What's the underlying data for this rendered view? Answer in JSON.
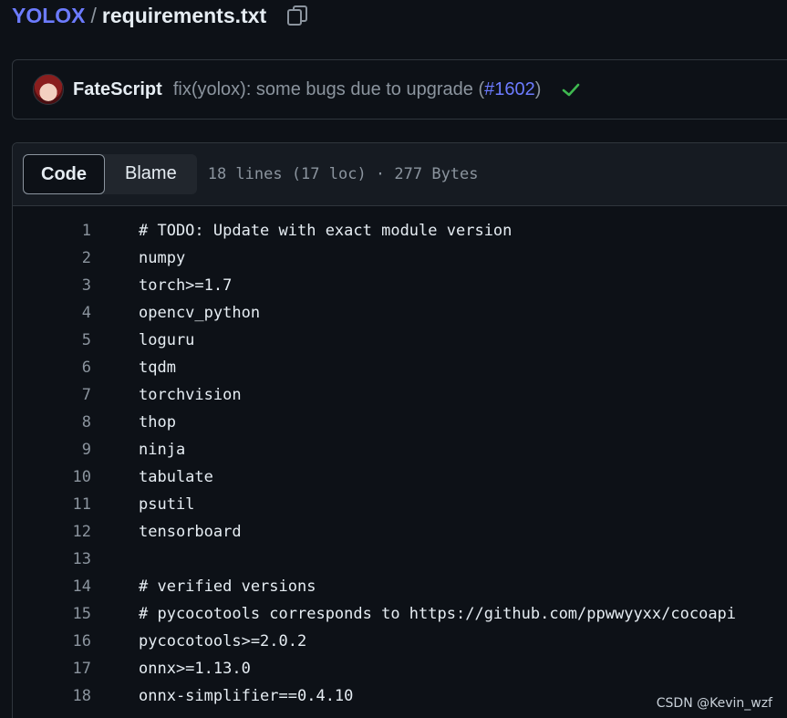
{
  "breadcrumb": {
    "repo": "YOLOX",
    "separator": "/",
    "file": "requirements.txt"
  },
  "commit": {
    "author": "FateScript",
    "message_prefix": "fix(yolox): some bugs due to upgrade (",
    "pr_link": "#1602",
    "message_suffix": ")",
    "status_color": "#3fb950"
  },
  "file_header": {
    "code_tab": "Code",
    "blame_tab": "Blame",
    "meta": "18 lines (17 loc) · 277 Bytes"
  },
  "code_lines": [
    {
      "num": "1",
      "text": "# TODO: Update with exact module version"
    },
    {
      "num": "2",
      "text": "numpy"
    },
    {
      "num": "3",
      "text": "torch>=1.7"
    },
    {
      "num": "4",
      "text": "opencv_python"
    },
    {
      "num": "5",
      "text": "loguru"
    },
    {
      "num": "6",
      "text": "tqdm"
    },
    {
      "num": "7",
      "text": "torchvision"
    },
    {
      "num": "8",
      "text": "thop"
    },
    {
      "num": "9",
      "text": "ninja"
    },
    {
      "num": "10",
      "text": "tabulate"
    },
    {
      "num": "11",
      "text": "psutil"
    },
    {
      "num": "12",
      "text": "tensorboard"
    },
    {
      "num": "13",
      "text": ""
    },
    {
      "num": "14",
      "text": "# verified versions"
    },
    {
      "num": "15",
      "text": "# pycocotools corresponds to https://github.com/ppwwyyxx/cocoapi"
    },
    {
      "num": "16",
      "text": "pycocotools>=2.0.2"
    },
    {
      "num": "17",
      "text": "onnx>=1.13.0"
    },
    {
      "num": "18",
      "text": "onnx-simplifier==0.4.10"
    }
  ],
  "watermark": "CSDN @Kevin_wzf",
  "colors": {
    "link": "#6c7bff",
    "background": "#0d1117",
    "muted": "#8b949e"
  }
}
